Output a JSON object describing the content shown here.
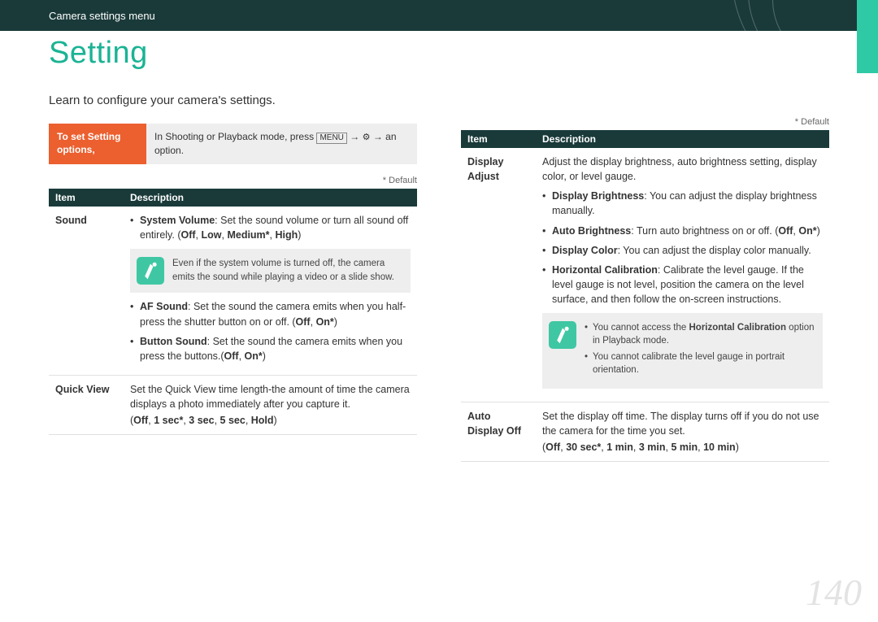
{
  "topbar": {
    "breadcrumb": "Camera settings menu"
  },
  "page": {
    "title": "Setting",
    "intro": "Learn to configure your camera's settings.",
    "number": "140"
  },
  "labels": {
    "default_note": "* Default",
    "item": "Item",
    "description": "Description"
  },
  "instruction": {
    "label": "To set Setting options,",
    "pre": "In Shooting or Playback mode, press ",
    "menu_btn": "MENU",
    "mid": " → ",
    "gear": "⚙",
    "post": " → an option."
  },
  "left": {
    "rows": [
      {
        "item": "Sound",
        "bullets": [
          {
            "label": "System Volume",
            "text": ": Set the sound volume or turn all sound off entirely. (",
            "opts": [
              "Off",
              "Low",
              "Medium*",
              "High"
            ],
            "tail": ")"
          },
          {
            "note": "Even if the system volume is turned off, the camera emits the sound while playing a video or a slide show."
          },
          {
            "label": "AF Sound",
            "text": ": Set the sound the camera emits when you half-press the shutter button on or off. (",
            "opts": [
              "Off",
              "On*"
            ],
            "tail": ")"
          },
          {
            "label": "Button Sound",
            "text": ": Set the sound the camera emits when you press the buttons.(",
            "opts": [
              "Off",
              "On*"
            ],
            "tail": ")"
          }
        ]
      },
      {
        "item": "Quick View",
        "plain": "Set the Quick View time length-the amount of time the camera displays a photo immediately after you capture it.",
        "opts_line": {
          "opts": [
            "Off",
            "1 sec*",
            "3 sec",
            "5 sec",
            "Hold"
          ]
        }
      }
    ]
  },
  "right": {
    "rows": [
      {
        "item": "Display Adjust",
        "lead": "Adjust the display brightness, auto brightness setting, display color, or level gauge.",
        "bullets": [
          {
            "label": "Display Brightness",
            "text": ": You can adjust the display brightness manually."
          },
          {
            "label": "Auto Brightness",
            "text": ": Turn auto brightness on or off. (",
            "opts": [
              "Off",
              "On*"
            ],
            "tail": ")"
          },
          {
            "label": "Display Color",
            "text": ": You can adjust the display color manually."
          },
          {
            "label": "Horizontal Calibration",
            "text": ": Calibrate the level gauge. If the level gauge is not level, position the camera on the level surface, and then follow the on-screen instructions."
          }
        ],
        "notes": [
          {
            "pre": "You cannot access the ",
            "bold": "Horizontal Calibration",
            "post": " option in Playback mode."
          },
          {
            "pre": "You cannot calibrate the level gauge in portrait orientation.",
            "bold": "",
            "post": ""
          }
        ]
      },
      {
        "item": "Auto Display Off",
        "plain": "Set the display off time. The display turns off if you do not use the camera for the time you set.",
        "opts_line": {
          "opts": [
            "Off",
            "30 sec*",
            "1 min",
            "3 min",
            "5 min",
            "10 min"
          ]
        }
      }
    ]
  }
}
